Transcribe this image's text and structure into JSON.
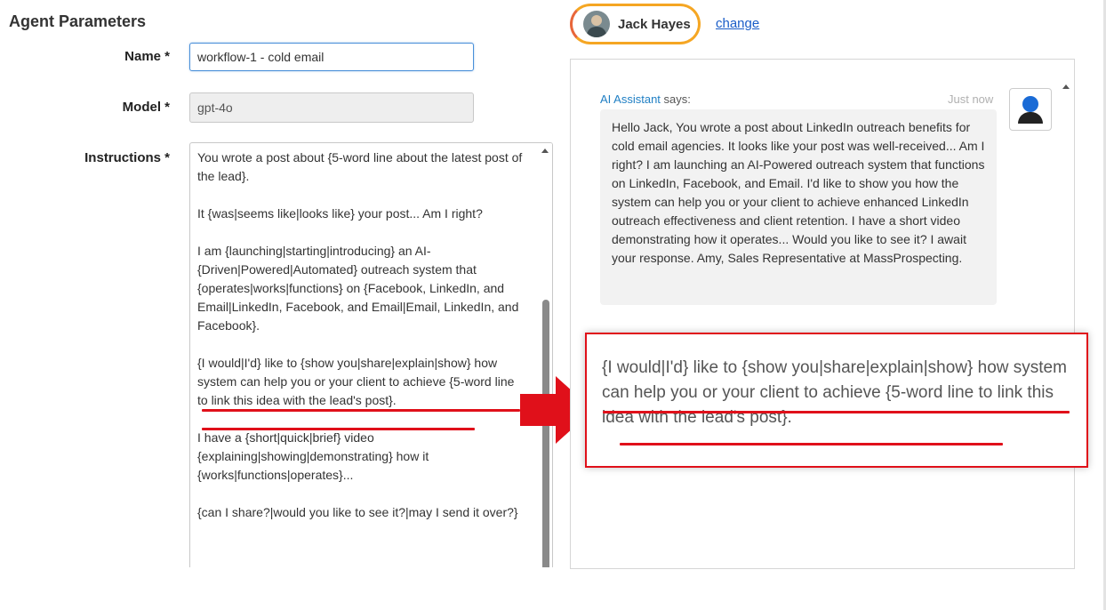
{
  "agent_parameters": {
    "title": "Agent Parameters",
    "name_label": "Name *",
    "name_value": "workflow-1 - cold email",
    "model_label": "Model *",
    "model_value": "gpt-4o",
    "instructions_label": "Instructions *",
    "instructions_paragraphs": [
      "You wrote a post about {5-word line about the latest post of the lead}.",
      "It {was|seems like|looks like} your post... Am I right?",
      "I am {launching|starting|introducing} an AI-{Driven|Powered|Automated} outreach system that {operates|works|functions} on {Facebook, LinkedIn, and Email|LinkedIn, Facebook, and Email|Email, LinkedIn, and Facebook}.",
      "{I would|I'd} like to {show you|share|explain|show} how system can help you or your client to achieve {5-word line to link this idea with the lead's post}.",
      "I have a {short|quick|brief} video {explaining|showing|demonstrating} how it {works|functions|operates}...",
      "{can I share?|would you like to see it?|may I send it over?}"
    ]
  },
  "user": {
    "name": "Jack Hayes",
    "change_link": "change"
  },
  "chat": {
    "sender_name": "AI Assistant",
    "sender_suffix": " says:",
    "timestamp": "Just now",
    "message": "Hello Jack, You wrote a post about LinkedIn outreach benefits for cold email agencies. It looks like your post was well-received... Am I right? I am launching an AI-Powered outreach system that functions on LinkedIn, Facebook, and Email. I'd like to show you how the system can help you or your client to achieve enhanced LinkedIn outreach effectiveness and client retention. I have a short video demonstrating how it operates... Would you like to see it? I await your response. Amy, Sales Representative at MassProspecting."
  },
  "zoom_callout": {
    "text": "{I would|I'd} like to {show you|share|explain|show} how system can help you or your client to achieve {5-word line to link this idea with the lead's post}."
  },
  "colors": {
    "highlight_red": "#e0101a",
    "link_blue": "#1a5dc8",
    "pill_border": "#f5a623"
  }
}
